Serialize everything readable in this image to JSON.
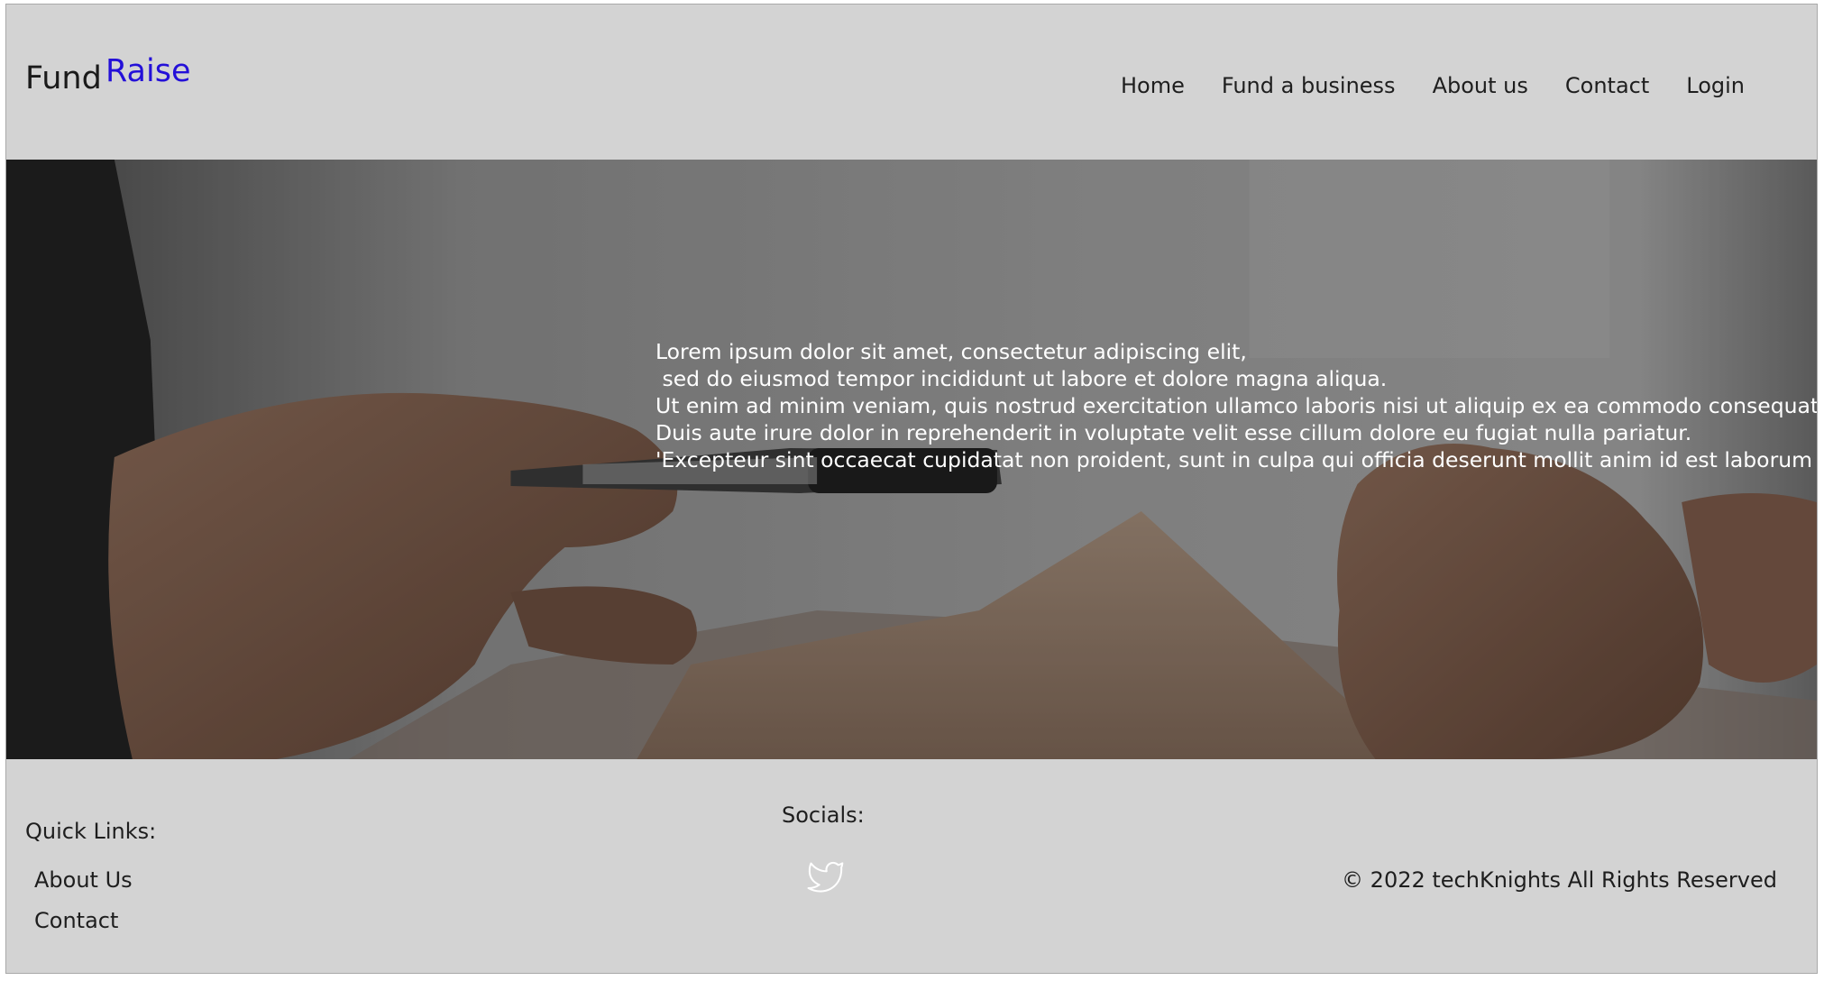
{
  "brand": {
    "name_part1": "Fund",
    "name_part2": "Raise",
    "accent_color": "#2410d8"
  },
  "nav": {
    "items": [
      {
        "label": "Home"
      },
      {
        "label": "Fund a business"
      },
      {
        "label": "About us"
      },
      {
        "label": "Contact"
      },
      {
        "label": "Login"
      }
    ]
  },
  "hero": {
    "text": "Lorem ipsum dolor sit amet, consectetur adipiscing elit,\n sed do eiusmod tempor incididunt ut labore et dolore magna aliqua.\nUt enim ad minim veniam, quis nostrud exercitation ullamco laboris nisi ut aliquip ex ea commodo consequat.\nDuis aute irure dolor in reprehenderit in voluptate velit esse cillum dolore eu fugiat nulla pariatur.\n'Excepteur sint occaecat cupidatat non proident, sunt in culpa qui officia deserunt mollit anim id est laborum"
  },
  "footer": {
    "quick_links_title": "Quick Links:",
    "quick_links": [
      {
        "label": "About Us"
      },
      {
        "label": "Contact"
      }
    ],
    "socials_title": "Socials:",
    "social_icons": [
      "twitter-icon"
    ],
    "copyright": "© 2022 techKnights All Rights Reserved"
  }
}
